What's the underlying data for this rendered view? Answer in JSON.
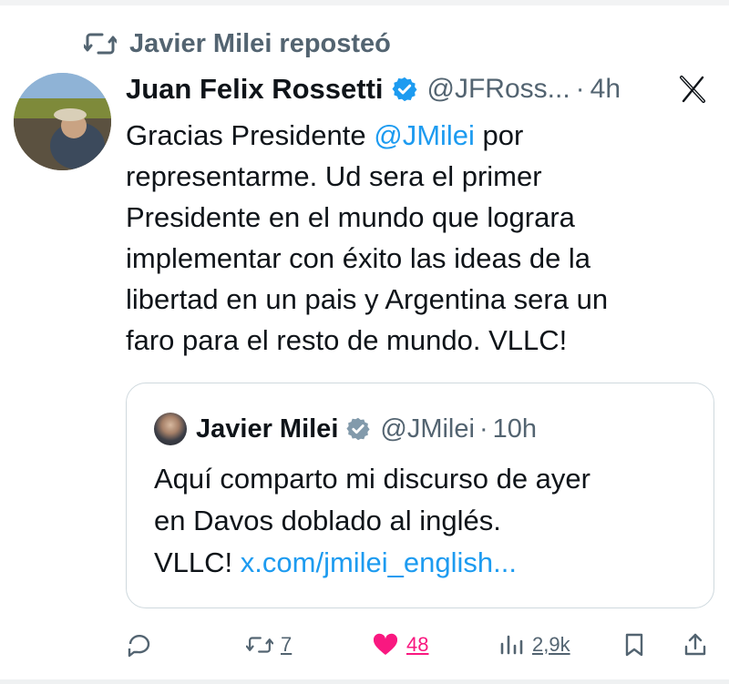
{
  "repost": {
    "label": "Javier Milei reposteó",
    "icon": "repost-icon"
  },
  "tweet": {
    "author": "Juan Felix Rossetti",
    "handle": "@JFRoss...",
    "time": "4h",
    "lines": [
      {
        "prefix": "Gracias Presidente ",
        "mention": "@JMilei",
        "suffix": " por"
      },
      "representarme. Ud sera el primer",
      "Presidente en el mundo que lograra",
      "implementar con éxito las ideas de la",
      "libertad en un pais y Argentina sera un",
      "faro para el resto de mundo. VLLC!"
    ]
  },
  "quote": {
    "author": "Javier Milei",
    "handle": "@JMilei",
    "time": "10h",
    "lines": [
      "Aquí comparto mi discurso de ayer",
      "en Davos doblado al inglés."
    ],
    "last_line_prefix": "VLLC! ",
    "link": "x.com/jmilei_english..."
  },
  "actions": {
    "retweets": "7",
    "likes": "48",
    "views": "2,9k"
  },
  "colors": {
    "accent": "#1d9bf0",
    "like": "#f91880",
    "muted": "#536471",
    "verified": "#1d9bf0",
    "quote_verified": "#829aab"
  }
}
